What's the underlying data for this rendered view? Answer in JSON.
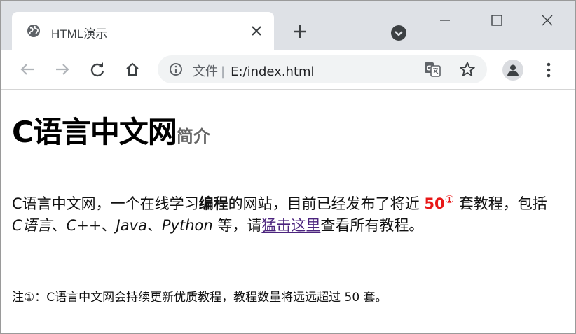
{
  "window": {
    "tab_title": "HTML演示",
    "address_scheme": "文件",
    "address_separator": "|",
    "address_path": "E:/index.html"
  },
  "icons": {
    "tab": "globe-icon",
    "tab_close": "close-icon",
    "new_tab": "plus-icon",
    "tab_search": "tab-search-icon",
    "minimize": "minimize-icon",
    "maximize": "maximize-icon",
    "close_window": "close-icon",
    "back": "arrow-left-icon",
    "forward": "arrow-right-icon",
    "reload": "reload-icon",
    "home": "home-icon",
    "info": "info-icon",
    "translate": "translate-icon",
    "bookmark": "star-icon",
    "profile": "person-icon",
    "menu": "kebab-menu-icon"
  },
  "page": {
    "title_main": "C语言中文网",
    "title_small": "简介",
    "intro": {
      "p1": "C语言中文网，一个在线学习",
      "bold": "编程",
      "p2": "的网站，目前已经发布了将近 ",
      "num": "50",
      "sup": "①",
      "p3": " 套教程，包括",
      "c": "C语言",
      "sep1": "、",
      "cpp": "C++",
      "sep2": "、",
      "java": "Java",
      "sep3": "、",
      "python": "Python",
      "p4": " 等，请",
      "link": "猛击这里",
      "p5": "查看所有教程。"
    },
    "note": "注①：C语言中文网会持续更新优质教程，教程数量将远远超过 50 套。"
  },
  "colors": {
    "tabstrip": "#dee1e6",
    "omnibox": "#f1f3f4",
    "highlight_number": "#e81717",
    "link": "#4b237d",
    "subtitle_gray": "#666666"
  }
}
